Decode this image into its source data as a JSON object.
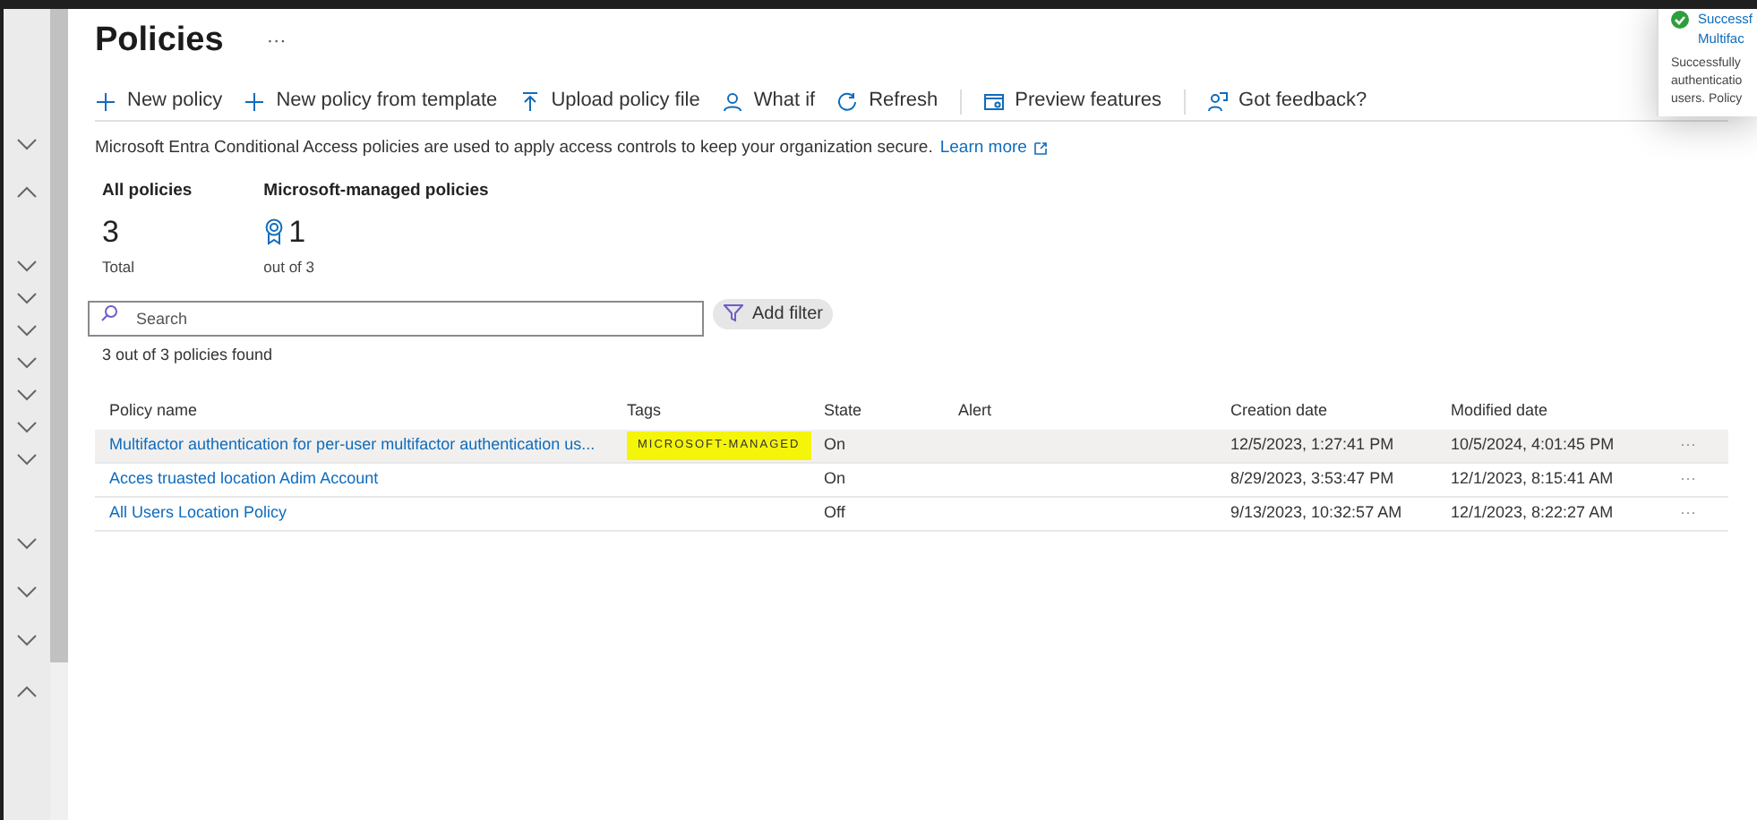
{
  "page": {
    "title": "Policies",
    "more": "···"
  },
  "toolbar": [
    {
      "kind": "plus",
      "label": "New policy"
    },
    {
      "kind": "plus",
      "label": "New policy from template"
    },
    {
      "kind": "upload",
      "label": "Upload policy file"
    },
    {
      "kind": "person",
      "label": "What if"
    },
    {
      "kind": "refresh",
      "label": "Refresh",
      "divider_after": true
    },
    {
      "kind": "preview",
      "label": "Preview features",
      "divider_after": true
    },
    {
      "kind": "feedback",
      "label": "Got feedback?"
    }
  ],
  "description": {
    "text": "Microsoft Entra Conditional Access policies are used to apply access controls to keep your organization secure.",
    "link": "Learn more"
  },
  "stats": [
    {
      "kind": "plain",
      "label": "All policies",
      "value": "3",
      "caption": "Total"
    },
    {
      "kind": "badge",
      "label": "Microsoft-managed policies",
      "value": "1",
      "caption": "out of 3"
    }
  ],
  "search": {
    "placeholder": "Search"
  },
  "filter_button": "Add filter",
  "result_count": "3 out of 3 policies found",
  "table": {
    "columns": [
      "Policy name",
      "Tags",
      "State",
      "Alert",
      "Creation date",
      "Modified date"
    ],
    "rows": [
      {
        "name": "Multifactor authentication for per-user multifactor authentication us...",
        "tag": "MICROSOFT-MANAGED",
        "tag_highlighted": true,
        "state": "On",
        "created": "12/5/2023, 1:27:41 PM",
        "modified": "10/5/2024, 4:01:45 PM",
        "more": "···",
        "selected": true
      },
      {
        "name": "Acces truasted location Adim Account",
        "state": "On",
        "created": "8/29/2023, 3:53:47 PM",
        "modified": "12/1/2023, 8:15:41 AM",
        "more": "···",
        "selected": false
      },
      {
        "name": "All Users Location Policy",
        "state": "Off",
        "created": "9/13/2023, 10:32:57 AM",
        "modified": "12/1/2023, 8:22:27 AM",
        "more": "···",
        "selected": false
      }
    ]
  },
  "notification": {
    "title_lines": [
      "Successf",
      "Multifac"
    ],
    "body_lines": [
      "Successfully",
      "authenticatio",
      "users. Policy"
    ]
  }
}
